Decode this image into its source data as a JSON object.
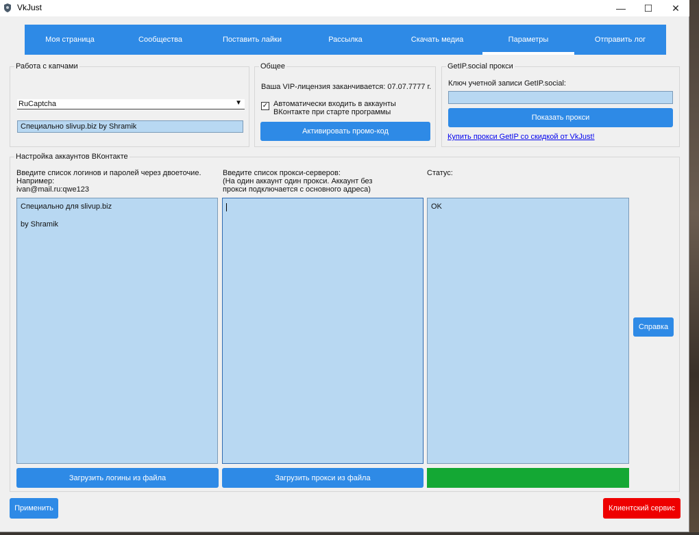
{
  "window": {
    "title": "VkJust",
    "min_glyph": "—",
    "max_glyph": "☐",
    "close_glyph": "✕"
  },
  "tabs": [
    {
      "label": "Моя страница"
    },
    {
      "label": "Сообщества"
    },
    {
      "label": "Поставить лайки"
    },
    {
      "label": "Рассылка"
    },
    {
      "label": "Скачать медиа"
    },
    {
      "label": "Параметры",
      "active": true
    },
    {
      "label": "Отправить лог"
    }
  ],
  "captcha": {
    "legend": "Работа с капчами",
    "service_selected": "RuCaptcha",
    "key_value": "Специально slivup.biz by Shramik"
  },
  "general": {
    "legend": "Общее",
    "vip_text": "Ваша VIP-лицензия заканчивается: 07.07.7777 г.",
    "autologin_checked": true,
    "autologin_label_line1": "Автоматически входить в аккаунты",
    "autologin_label_line2": "ВКонтакте при старте программы",
    "promo_button": "Активировать промо-код"
  },
  "getip": {
    "legend": "GetIP.social прокси",
    "key_label": "Ключ учетной записи GetIP.social:",
    "key_value": "",
    "show_button": "Показать прокси",
    "buy_link": "Купить прокси GetIP со скидкой от VkJust!"
  },
  "accounts": {
    "legend": "Настройка аккаунтов ВКонтакте",
    "logins_label_line1": "Введите список логинов и паролей через двоеточие.",
    "logins_label_line2": "Например:",
    "logins_label_line3": "ivan@mail.ru:qwe123",
    "logins_value": "Специально для slivup.biz\n\nby Shramik",
    "proxies_label_line1": "Введите список прокси-серверов:",
    "proxies_label_line2": "(На один аккаунт один прокси. Аккаунт без",
    "proxies_label_line3": "прокси подключается с основного адреса)",
    "proxies_value": "",
    "status_label": "Статус:",
    "status_value": "OK",
    "load_logins_button": "Загрузить логины из файла",
    "load_proxies_button": "Загрузить прокси из файла",
    "help_button": "Справка",
    "status_bar_color": "#14a834"
  },
  "footer": {
    "apply_button": "Применить",
    "client_service_button": "Клиентский сервис"
  },
  "colors": {
    "accent": "#2e8ae6",
    "danger": "#ee0000",
    "field_bg": "#b8d8f2",
    "ok_green": "#14a834"
  }
}
